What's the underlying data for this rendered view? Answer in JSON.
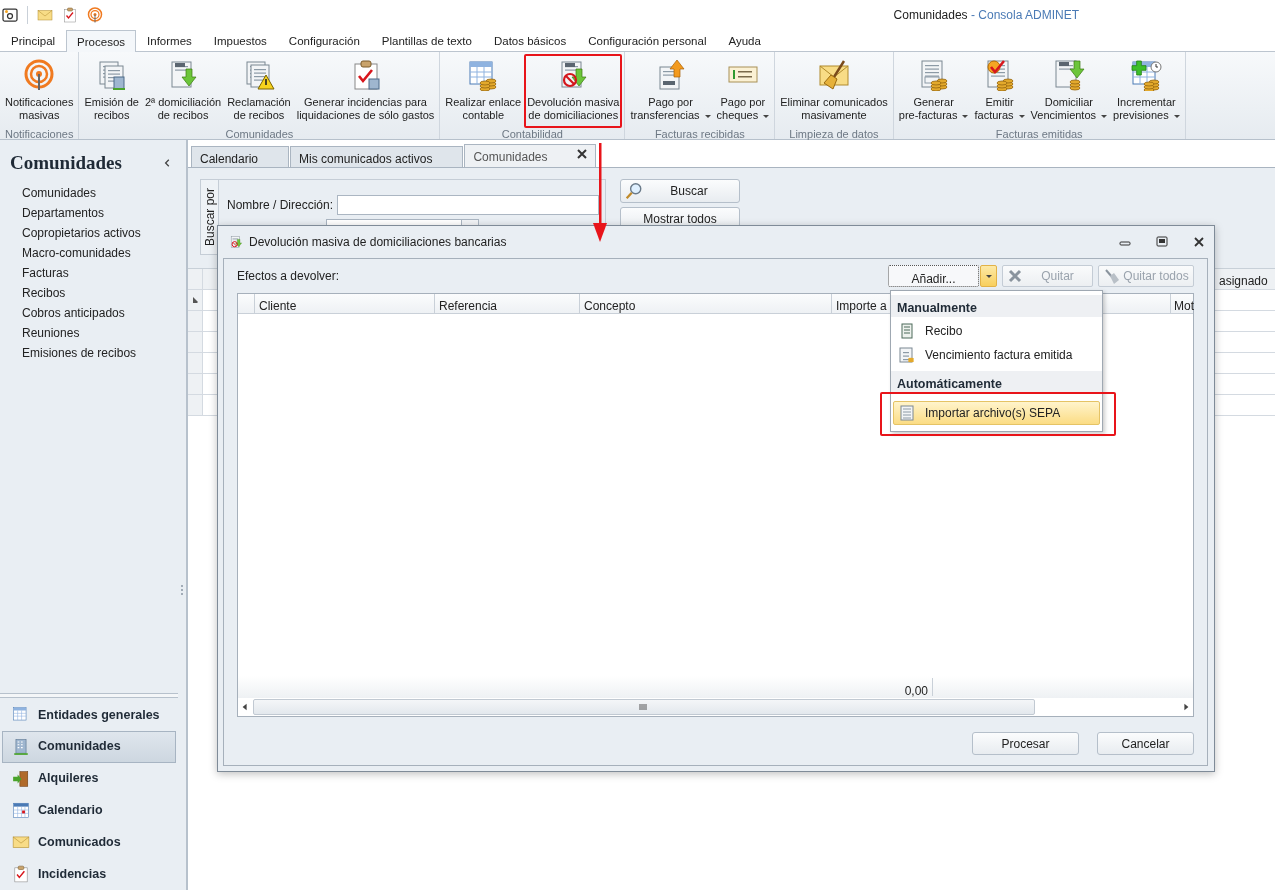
{
  "window": {
    "document": "Comunidades",
    "app": "- Consola ADMINET"
  },
  "ribbon_tabs": [
    {
      "label": "Principal",
      "selected": false
    },
    {
      "label": "Procesos",
      "selected": true
    },
    {
      "label": "Informes",
      "selected": false
    },
    {
      "label": "Impuestos",
      "selected": false
    },
    {
      "label": "Configuración",
      "selected": false
    },
    {
      "label": "Plantillas de texto",
      "selected": false
    },
    {
      "label": "Datos básicos",
      "selected": false
    },
    {
      "label": "Configuración personal",
      "selected": false
    },
    {
      "label": "Ayuda",
      "selected": false
    }
  ],
  "ribbon_groups": [
    {
      "label": "Notificaciones",
      "buttons": [
        {
          "lines": [
            "Notificaciones",
            "masivas"
          ],
          "dropdown": false,
          "highlighted": false
        }
      ]
    },
    {
      "label": "Comunidades",
      "buttons": [
        {
          "lines": [
            "Emisión de",
            "recibos"
          ],
          "dropdown": false,
          "highlighted": false
        },
        {
          "lines": [
            "2ª domiciliación",
            "de recibos"
          ],
          "dropdown": false,
          "highlighted": false
        },
        {
          "lines": [
            "Reclamación",
            "de recibos"
          ],
          "dropdown": false,
          "highlighted": false
        },
        {
          "lines": [
            "Generar incidencias para",
            "liquidaciones de sólo gastos"
          ],
          "dropdown": false,
          "highlighted": false
        }
      ]
    },
    {
      "label": "Contabilidad",
      "buttons": [
        {
          "lines": [
            "Realizar enlace",
            "contable"
          ],
          "dropdown": false,
          "highlighted": false
        },
        {
          "lines": [
            "Devolución masiva",
            "de domiciliaciones"
          ],
          "dropdown": false,
          "highlighted": true
        }
      ]
    },
    {
      "label": "Facturas recibidas",
      "buttons": [
        {
          "lines": [
            "Pago por",
            "transferencias"
          ],
          "dropdown": true,
          "highlighted": false
        },
        {
          "lines": [
            "Pago por",
            "cheques"
          ],
          "dropdown": true,
          "highlighted": false
        }
      ]
    },
    {
      "label": "Limpieza de datos",
      "buttons": [
        {
          "lines": [
            "Eliminar comunicados",
            "masivamente"
          ],
          "dropdown": false,
          "highlighted": false
        }
      ]
    },
    {
      "label": "Facturas emitidas",
      "buttons": [
        {
          "lines": [
            "Generar",
            "pre-facturas"
          ],
          "dropdown": true,
          "highlighted": false
        },
        {
          "lines": [
            "Emitir",
            "facturas"
          ],
          "dropdown": true,
          "highlighted": false
        },
        {
          "lines": [
            "Domiciliar",
            "Vencimientos"
          ],
          "dropdown": true,
          "highlighted": false
        },
        {
          "lines": [
            "Incrementar",
            "previsiones"
          ],
          "dropdown": true,
          "highlighted": false
        }
      ]
    }
  ],
  "sidebar": {
    "title": "Comunidades",
    "links": [
      "Comunidades",
      "Departamentos",
      "Copropietarios activos",
      "Macro-comunidades",
      "Facturas",
      "Recibos",
      "Cobros anticipados",
      "Reuniones",
      "Emisiones de recibos"
    ],
    "modules": [
      {
        "label": "Entidades generales",
        "selected": false
      },
      {
        "label": "Comunidades",
        "selected": true
      },
      {
        "label": "Alquileres",
        "selected": false
      },
      {
        "label": "Calendario",
        "selected": false
      },
      {
        "label": "Comunicados",
        "selected": false
      },
      {
        "label": "Incidencias",
        "selected": false
      }
    ]
  },
  "doc_tabs": [
    {
      "label": "Calendario",
      "selected": false,
      "closable": false
    },
    {
      "label": "Mis comunicados activos",
      "selected": false,
      "closable": false
    },
    {
      "label": "Comunidades",
      "selected": true,
      "closable": true
    }
  ],
  "search": {
    "side_label": "Buscar por",
    "name_label": "Nombre / Dirección:",
    "buttons": [
      "Buscar",
      "Mostrar todos"
    ]
  },
  "grid": {
    "column_header": "asignado"
  },
  "dialog": {
    "title": "Devolución masiva de domiciliaciones bancarias",
    "list_label": "Efectos a devolver:",
    "toolbar": [
      {
        "label": "Añadir...",
        "disabled": false,
        "split": true,
        "open": true
      },
      {
        "label": "Quitar",
        "disabled": true,
        "split": false,
        "open": false
      },
      {
        "label": "Quitar todos",
        "disabled": true,
        "split": false,
        "open": false
      }
    ],
    "columns": [
      "Cliente",
      "Referencia",
      "Concepto",
      "Importe a",
      "Mot"
    ],
    "total": "0,00",
    "buttons": [
      "Procesar",
      "Cancelar"
    ]
  },
  "menu": {
    "sections": [
      {
        "header": "Manualmente",
        "items": [
          {
            "label": "Recibo",
            "selected": false,
            "annotated": false
          },
          {
            "label": "Vencimiento factura emitida",
            "selected": false,
            "annotated": false
          }
        ]
      },
      {
        "header": "Automáticamente",
        "items": [
          {
            "label": "Importar archivo(s) SEPA",
            "selected": true,
            "annotated": true
          }
        ]
      }
    ]
  }
}
